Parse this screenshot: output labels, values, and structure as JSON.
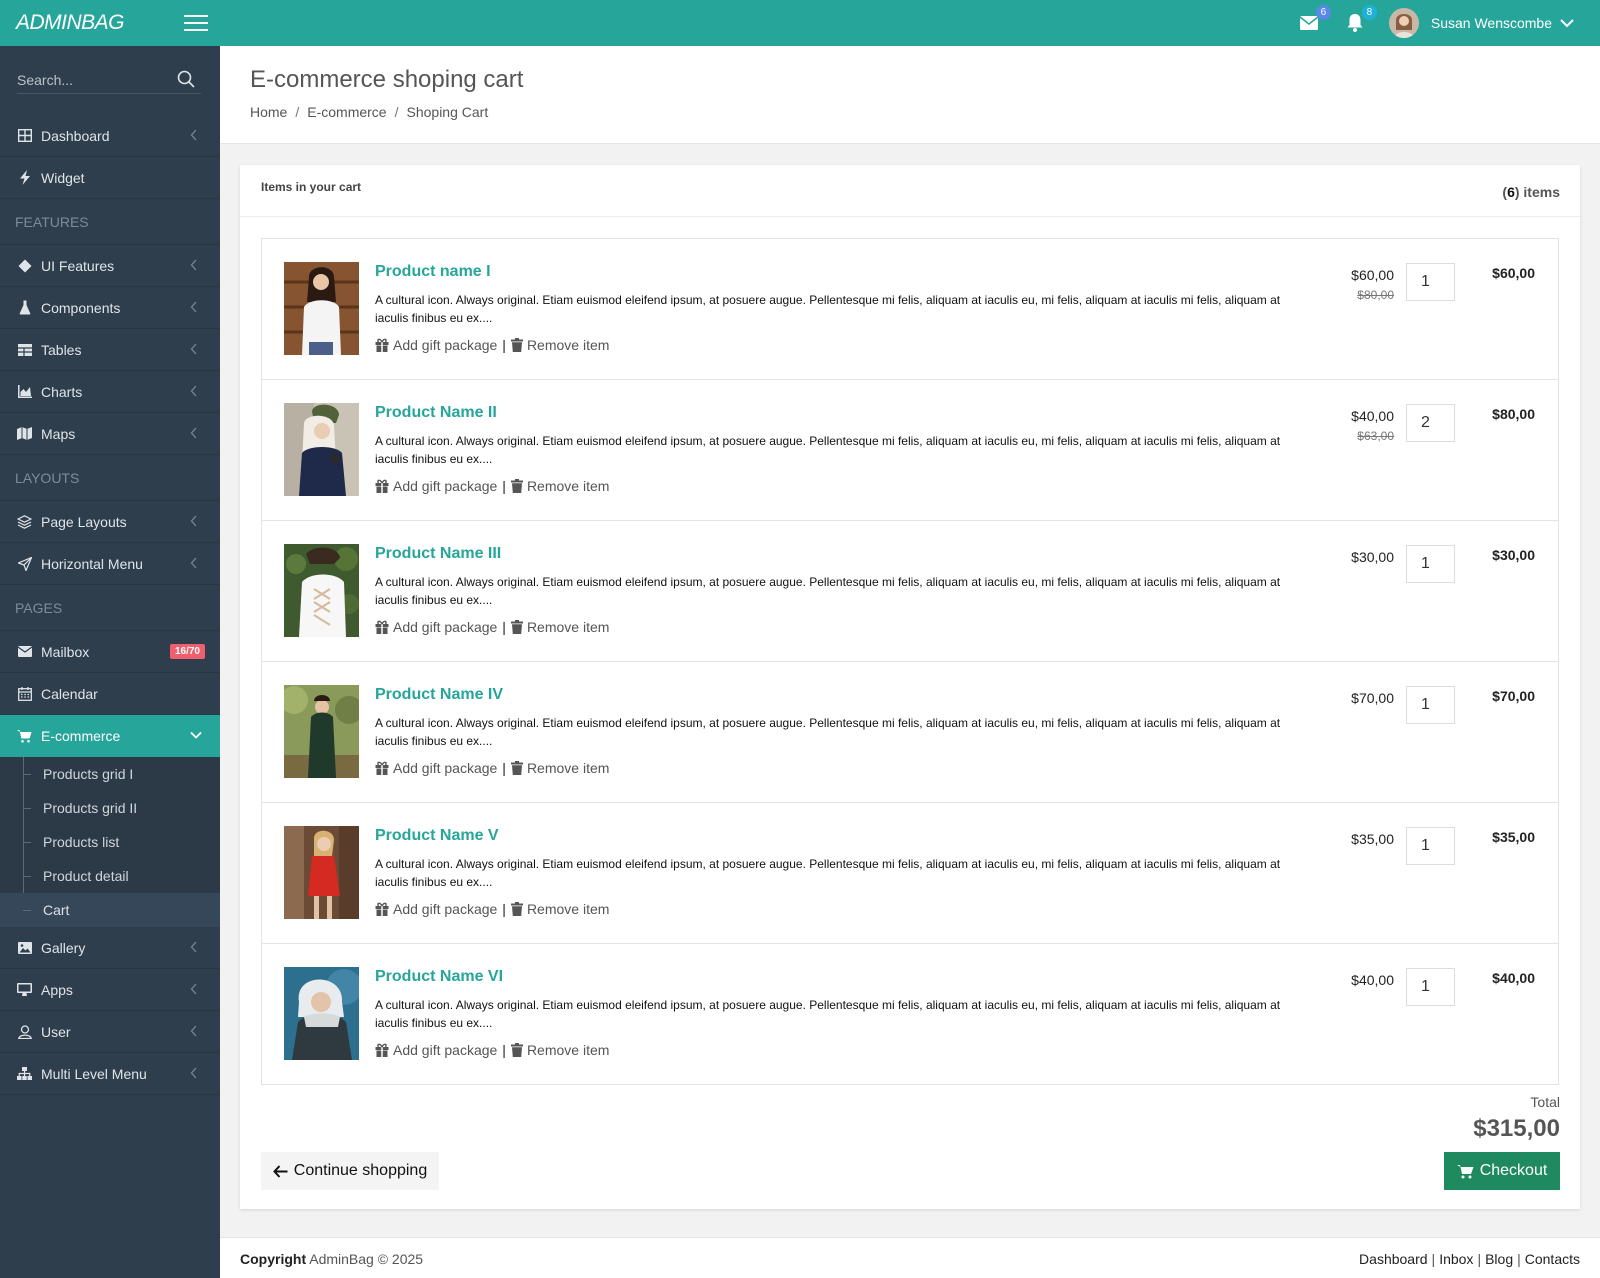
{
  "colors": {
    "brand": "#26a69a",
    "sidebar_bg": "#2f3e4c",
    "checkout": "#1f8a5f",
    "badge_red": "#ef5f6e"
  },
  "topbar": {
    "logo": "ADMINBAG",
    "mail_badge": "6",
    "bell_badge": "8",
    "user_name": "Susan Wenscombe"
  },
  "sidebar": {
    "search_placeholder": "Search...",
    "items": {
      "dashboard": "Dashboard",
      "widget": "Widget",
      "features_header": "FEATURES",
      "ui_features": "UI Features",
      "components": "Components",
      "tables": "Tables",
      "charts": "Charts",
      "maps": "Maps",
      "layouts_header": "LAYOUTS",
      "page_layouts": "Page Layouts",
      "horizontal_menu": "Horizontal Menu",
      "pages_header": "PAGES",
      "mailbox": "Mailbox",
      "mailbox_badge": "16/70",
      "calendar": "Calendar",
      "ecommerce": "E-commerce",
      "gallery": "Gallery",
      "apps": "Apps",
      "user": "User",
      "multi_level_menu": "Multi Level Menu"
    },
    "ecommerce_sub": [
      "Products grid I",
      "Products grid II",
      "Products list",
      "Product detail",
      "Cart"
    ]
  },
  "page": {
    "title": "E-commerce shoping cart",
    "breadcrumb": [
      "Home",
      "E-commerce",
      "Shoping Cart"
    ]
  },
  "cart": {
    "header": "Items in your cart",
    "count": "6",
    "count_suffix": "items",
    "gift_label": "Add gift package",
    "remove_label": "Remove item",
    "description": "A cultural icon. Always original. Etiam euismod eleifend ipsum, at posuere augue. Pellentesque mi felis, aliquam at iaculis eu, mi felis, aliquam at iaculis mi felis, aliquam at iaculis finibus eu ex....",
    "items": [
      {
        "name": "Product name I",
        "price": "$60,00",
        "old_price": "$80,00",
        "qty": "1",
        "subtotal": "$60,00"
      },
      {
        "name": "Product Name II",
        "price": "$40,00",
        "old_price": "$63,00",
        "qty": "2",
        "subtotal": "$80,00"
      },
      {
        "name": "Product Name III",
        "price": "$30,00",
        "old_price": "",
        "qty": "1",
        "subtotal": "$30,00"
      },
      {
        "name": "Product Name IV",
        "price": "$70,00",
        "old_price": "",
        "qty": "1",
        "subtotal": "$70,00"
      },
      {
        "name": "Product Name V",
        "price": "$35,00",
        "old_price": "",
        "qty": "1",
        "subtotal": "$35,00"
      },
      {
        "name": "Product Name VI",
        "price": "$40,00",
        "old_price": "",
        "qty": "1",
        "subtotal": "$40,00"
      }
    ],
    "total_label": "Total",
    "total_value": "$315,00",
    "continue_label": "Continue shopping",
    "checkout_label": "Checkout"
  },
  "footer": {
    "copyright_bold": "Copyright",
    "copyright_rest": "AdminBag © 2025",
    "links": [
      "Dashboard",
      "Inbox",
      "Blog",
      "Contacts"
    ]
  }
}
